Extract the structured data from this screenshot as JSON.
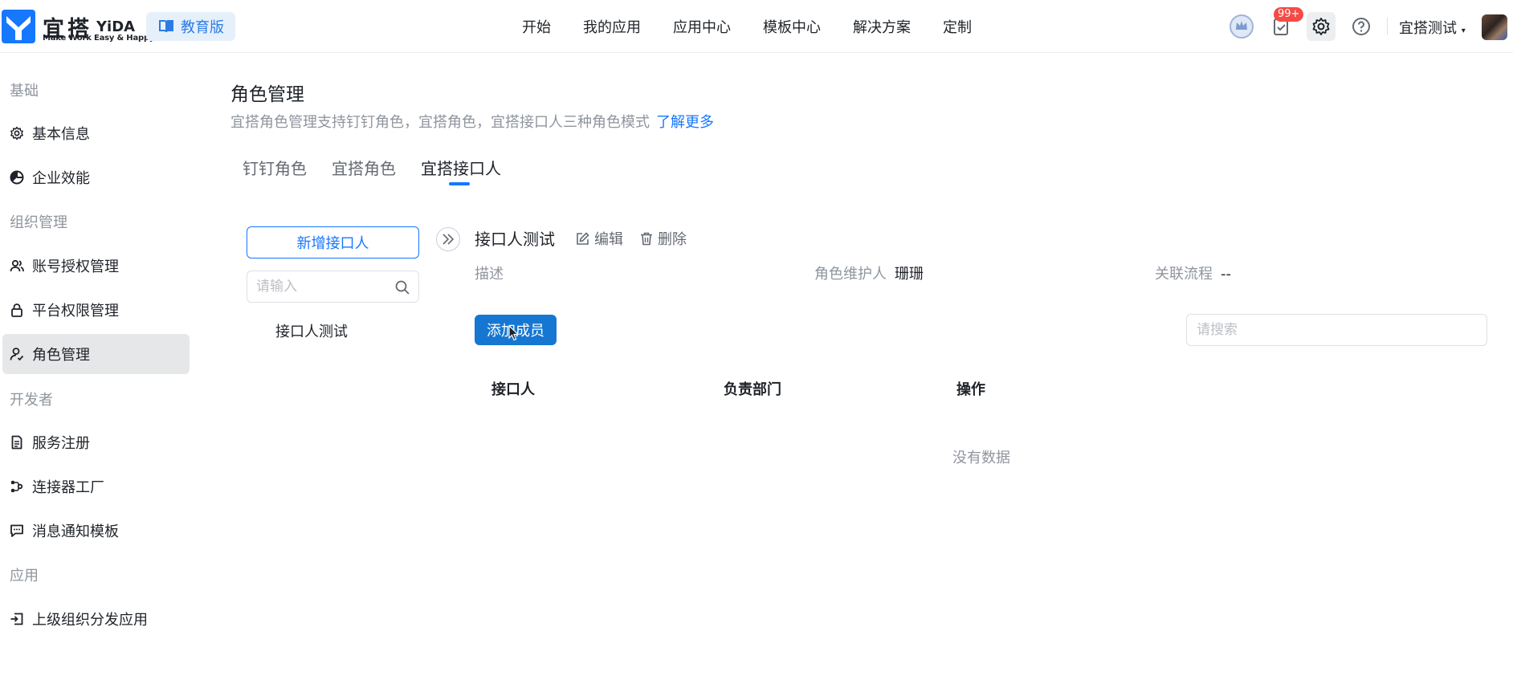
{
  "brand": {
    "name_cn": "宜搭",
    "name_en": "YiDA",
    "slogan": "Make Work Easy & Happy",
    "edition": "教育版",
    "accent": "#1677ff"
  },
  "topnav": [
    "开始",
    "我的应用",
    "应用中心",
    "模板中心",
    "解决方案",
    "定制"
  ],
  "header": {
    "notification_count": "99+",
    "user_name": "宜搭测试"
  },
  "sidebar": {
    "groups": [
      {
        "label": "基础",
        "items": [
          {
            "label": "基本信息",
            "icon": "gear-icon"
          },
          {
            "label": "企业效能",
            "icon": "pie-chart-icon"
          }
        ]
      },
      {
        "label": "组织管理",
        "items": [
          {
            "label": "账号授权管理",
            "icon": "users-icon"
          },
          {
            "label": "平台权限管理",
            "icon": "lock-icon"
          },
          {
            "label": "角色管理",
            "icon": "role-icon",
            "active": true
          }
        ]
      },
      {
        "label": "开发者",
        "items": [
          {
            "label": "服务注册",
            "icon": "document-icon"
          },
          {
            "label": "连接器工厂",
            "icon": "connector-icon"
          },
          {
            "label": "消息通知模板",
            "icon": "message-icon"
          }
        ]
      },
      {
        "label": "应用",
        "items": [
          {
            "label": "上级组织分发应用",
            "icon": "distribute-icon"
          }
        ]
      }
    ]
  },
  "page": {
    "title": "角色管理",
    "description": "宜搭角色管理支持钉钉角色，宜搭角色，宜搭接口人三种角色模式",
    "learn_more": "了解更多",
    "tabs": [
      {
        "label": "钉钉角色"
      },
      {
        "label": "宜搭角色"
      },
      {
        "label": "宜搭接口人",
        "active": true
      }
    ]
  },
  "left_pane": {
    "add_button": "新增接口人",
    "search_placeholder": "请输入",
    "items": [
      "接口人测试"
    ]
  },
  "detail": {
    "title": "接口人测试",
    "edit_label": "编辑",
    "delete_label": "删除",
    "description_label": "描述",
    "maintainer_label": "角色维护人",
    "maintainer_value": "珊珊",
    "related_flow_label": "关联流程",
    "related_flow_value": "--",
    "add_member_button": "添加成员",
    "member_search_placeholder": "请搜索",
    "columns": [
      "接口人",
      "负责部门",
      "操作"
    ],
    "empty_text": "没有数据"
  }
}
